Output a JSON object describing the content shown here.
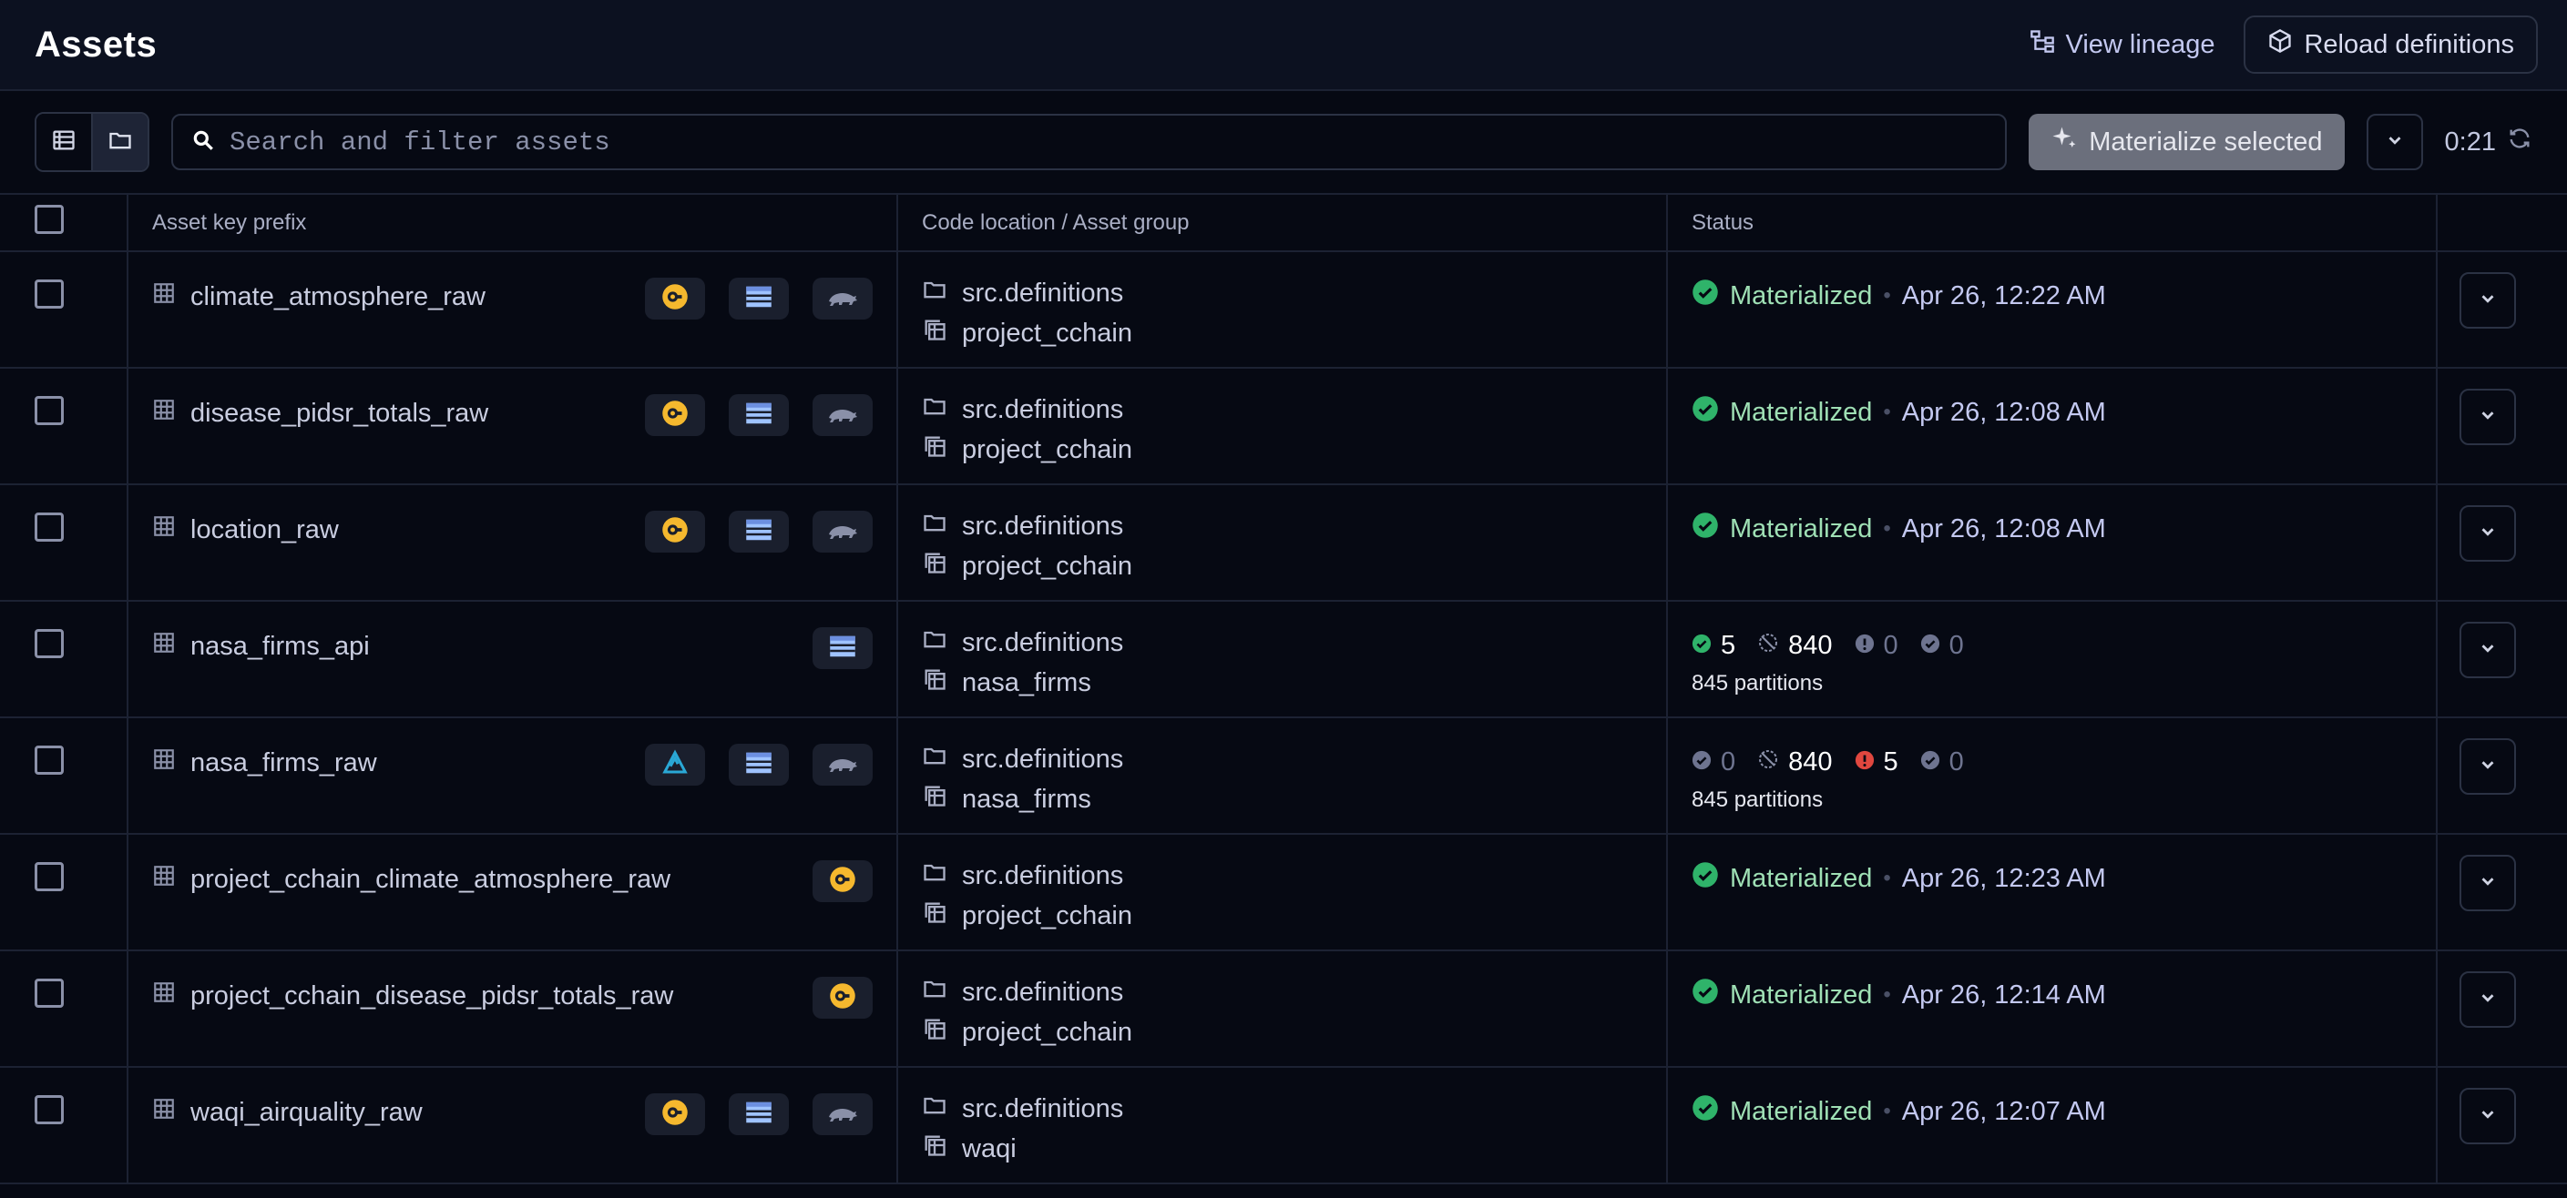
{
  "header": {
    "title": "Assets",
    "view_lineage": "View lineage",
    "reload": "Reload definitions"
  },
  "toolbar": {
    "search_placeholder": "Search and filter assets",
    "materialize": "Materialize selected",
    "timer": "0:21"
  },
  "table": {
    "columns": [
      "Asset key prefix",
      "Code location / Asset group",
      "Status"
    ],
    "rows": [
      {
        "key": "climate_atmosphere_raw",
        "badges": [
          "sling",
          "table",
          "polars"
        ],
        "location": "src.definitions",
        "group": "project_cchain",
        "status": {
          "type": "materialized",
          "label": "Materialized",
          "time": "Apr 26, 12:22 AM"
        }
      },
      {
        "key": "disease_pidsr_totals_raw",
        "badges": [
          "sling",
          "table",
          "polars"
        ],
        "location": "src.definitions",
        "group": "project_cchain",
        "status": {
          "type": "materialized",
          "label": "Materialized",
          "time": "Apr 26, 12:08 AM"
        }
      },
      {
        "key": "location_raw",
        "badges": [
          "sling",
          "table",
          "polars"
        ],
        "location": "src.definitions",
        "group": "project_cchain",
        "status": {
          "type": "materialized",
          "label": "Materialized",
          "time": "Apr 26, 12:08 AM"
        }
      },
      {
        "key": "nasa_firms_api",
        "badges": [
          "table"
        ],
        "location": "src.definitions",
        "group": "nasa_firms",
        "status": {
          "type": "partitions",
          "success": "5",
          "missing": "840",
          "failed": "0",
          "inprogress": "0",
          "partitions": "845 partitions"
        }
      },
      {
        "key": "nasa_firms_raw",
        "badges": [
          "delta",
          "table",
          "polars"
        ],
        "location": "src.definitions",
        "group": "nasa_firms",
        "status": {
          "type": "partitions",
          "success": "0",
          "missing": "840",
          "failed": "5",
          "inprogress": "0",
          "partitions": "845 partitions"
        }
      },
      {
        "key": "project_cchain_climate_atmosphere_raw",
        "badges": [
          "sling"
        ],
        "location": "src.definitions",
        "group": "project_cchain",
        "status": {
          "type": "materialized",
          "label": "Materialized",
          "time": "Apr 26, 12:23 AM"
        }
      },
      {
        "key": "project_cchain_disease_pidsr_totals_raw",
        "badges": [
          "sling"
        ],
        "location": "src.definitions",
        "group": "project_cchain",
        "status": {
          "type": "materialized",
          "label": "Materialized",
          "time": "Apr 26, 12:14 AM"
        }
      },
      {
        "key": "waqi_airquality_raw",
        "badges": [
          "sling",
          "table",
          "polars"
        ],
        "location": "src.definitions",
        "group": "waqi",
        "status": {
          "type": "materialized",
          "label": "Materialized",
          "time": "Apr 26, 12:07 AM"
        }
      }
    ]
  },
  "colors": {
    "background": "#060913",
    "topbar": "#0c1120",
    "success": "#2fb36a",
    "failed": "#e0473f",
    "sling_badge": "#f5b82e",
    "table_badge": "#9fc3ff",
    "delta_badge": "#2aa8d6"
  }
}
